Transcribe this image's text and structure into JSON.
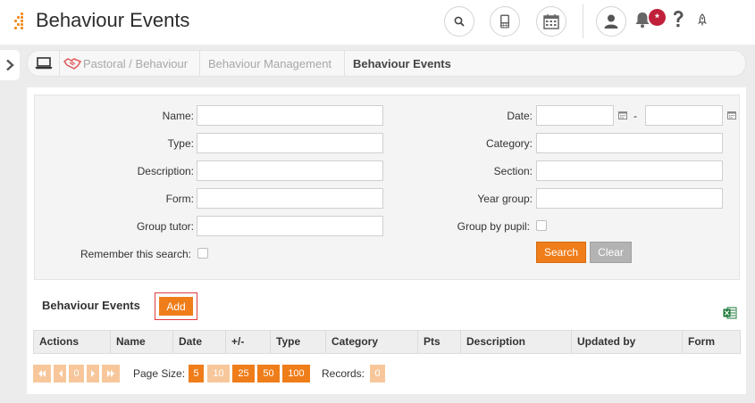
{
  "header": {
    "title": "Behaviour Events",
    "notification_badge": "*",
    "icons": [
      "search-icon",
      "phone-icon",
      "calendar-icon",
      "user-icon",
      "bell-icon",
      "help-icon",
      "rocket-icon"
    ]
  },
  "breadcrumb": {
    "items": [
      "Pastoral / Behaviour",
      "Behaviour Management",
      "Behaviour Events"
    ]
  },
  "search": {
    "name_label": "Name:",
    "type_label": "Type:",
    "description_label": "Description:",
    "form_label": "Form:",
    "group_tutor_label": "Group tutor:",
    "remember_label": "Remember this search:",
    "date_label": "Date:",
    "date_separator": "-",
    "category_label": "Category:",
    "section_label": "Section:",
    "year_group_label": "Year group:",
    "group_by_pupil_label": "Group by pupil:",
    "search_button": "Search",
    "clear_button": "Clear",
    "values": {
      "name": "",
      "type": "",
      "description": "",
      "form": "",
      "group_tutor": "",
      "date_from": "",
      "date_to": "",
      "category": "",
      "section": "",
      "year_group": ""
    }
  },
  "list": {
    "title": "Behaviour Events",
    "add_button": "Add",
    "columns": [
      "Actions",
      "Name",
      "Date",
      "+/-",
      "Type",
      "Category",
      "Pts",
      "Description",
      "Updated by",
      "Form"
    ]
  },
  "pager": {
    "current_page": "0",
    "page_size_label": "Page Size:",
    "page_sizes": [
      "5",
      "10",
      "25",
      "50",
      "100"
    ],
    "records_label": "Records:",
    "records": "0"
  },
  "colors": {
    "accent": "#ef7d1a",
    "accent_light": "#f7c79b",
    "badge": "#c0203a"
  }
}
